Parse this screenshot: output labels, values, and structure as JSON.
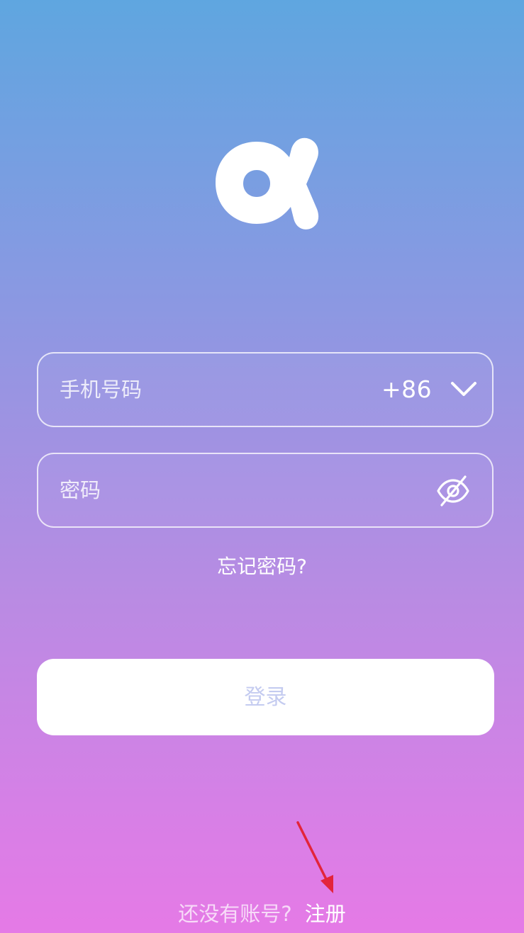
{
  "login_form": {
    "phone_placeholder": "手机号码",
    "country_code": "+86",
    "password_placeholder": "密码",
    "forgot_password": "忘记密码?",
    "login_button": "登录"
  },
  "footer": {
    "no_account_text": "还没有账号?",
    "register_link": "注册"
  },
  "icons": {
    "logo": "alpha-logo-icon",
    "country_dropdown": "chevron-down-icon",
    "password_visibility": "eye-slash-icon",
    "annotation": "red-arrow-icon"
  },
  "colors": {
    "gradient_top": "#5fa6e0",
    "gradient_bottom": "#e57ae6",
    "login_button_bg": "#ffffff",
    "login_button_text": "#c4cbf0",
    "annotation_arrow": "#e3243b"
  }
}
